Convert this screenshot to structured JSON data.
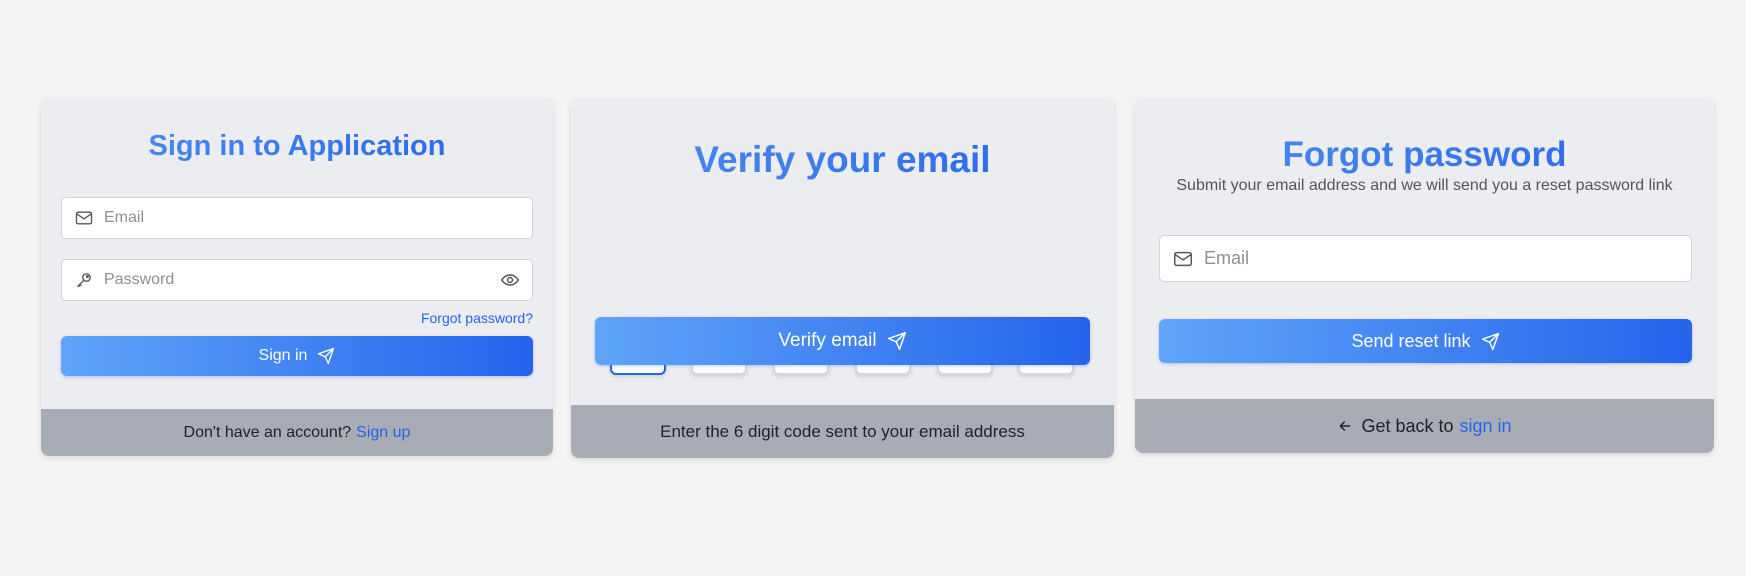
{
  "signin": {
    "title": "Sign in to Application",
    "email_placeholder": "Email",
    "password_placeholder": "Password",
    "forgot_link": "Forgot password?",
    "button_label": "Sign in",
    "footer_text": "Don't have an account?",
    "footer_link": "Sign up",
    "icons": {
      "email": "mail-icon",
      "password": "key-icon",
      "toggle": "eye-icon",
      "button": "send-icon"
    }
  },
  "verify": {
    "title": "Verify your email",
    "otp_digits": [
      "",
      "",
      "",
      "",
      "",
      ""
    ],
    "button_label": "Verify email",
    "footer_text": "Enter the 6 digit code sent to your email address",
    "icons": {
      "button": "send-icon"
    }
  },
  "forgot": {
    "title": "Forgot password",
    "subtitle": "Submit your email address and we will send you a reset password link",
    "email_placeholder": "Email",
    "button_label": "Send reset link",
    "footer_text": "Get back to",
    "footer_link": "sign in",
    "icons": {
      "email": "mail-icon",
      "button": "send-icon",
      "back": "arrow-left-icon"
    }
  },
  "colors": {
    "background": "#f5f4f5",
    "card": "#ecedf0",
    "footer": "#a8adb5",
    "accent": "#2563eb",
    "accent_light": "#60a5fa"
  }
}
